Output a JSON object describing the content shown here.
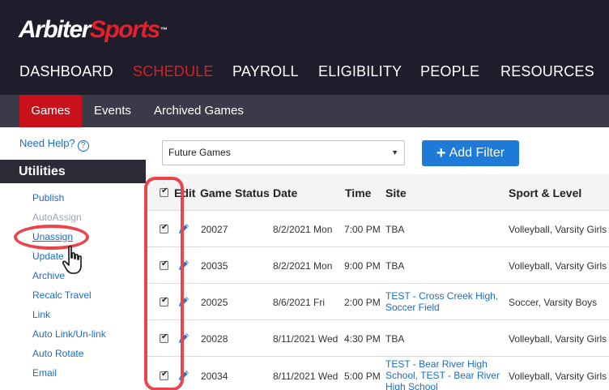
{
  "brand": {
    "logo_part1": "Arbiter",
    "logo_part2": "Sports",
    "logo_mark": "™"
  },
  "main_nav": [
    {
      "label": "DASHBOARD",
      "active": false
    },
    {
      "label": "SCHEDULE",
      "active": true
    },
    {
      "label": "PAYROLL",
      "active": false
    },
    {
      "label": "ELIGIBILITY",
      "active": false
    },
    {
      "label": "PEOPLE",
      "active": false
    },
    {
      "label": "RESOURCES",
      "active": false
    }
  ],
  "sub_nav": [
    {
      "label": "Games",
      "active": true
    },
    {
      "label": "Events",
      "active": false
    },
    {
      "label": "Archived Games",
      "active": false
    }
  ],
  "sidebar": {
    "help_label": "Need Help?",
    "help_icon": "question-circle-icon",
    "section_title": "Utilities",
    "items": [
      {
        "label": "Publish",
        "state": "normal"
      },
      {
        "label": "AutoAssign",
        "state": "disabled"
      },
      {
        "label": "Unassign",
        "state": "highlighted"
      },
      {
        "label": "Update",
        "state": "normal"
      },
      {
        "label": "Archive",
        "state": "normal"
      },
      {
        "label": "Recalc Travel",
        "state": "normal"
      },
      {
        "label": "Link",
        "state": "normal"
      },
      {
        "label": "Auto Link/Un-link",
        "state": "normal"
      },
      {
        "label": "Auto Rotate",
        "state": "normal"
      },
      {
        "label": "Email",
        "state": "normal"
      }
    ]
  },
  "filter": {
    "selected": "Future Games",
    "add_filter_label": "Add Filter"
  },
  "table": {
    "columns": [
      "Edit",
      "Game",
      "Status",
      "Date",
      "Time",
      "Site",
      "Sport & Level"
    ],
    "select_all_checked": true,
    "rows": [
      {
        "checked": true,
        "game": "20027",
        "status": "",
        "date": "8/2/2021 Mon",
        "time": "7:00 PM",
        "site": "TBA",
        "site_is_link": false,
        "sport_level": "Volleyball, Varsity Girls"
      },
      {
        "checked": true,
        "game": "20035",
        "status": "",
        "date": "8/2/2021 Mon",
        "time": "9:00 PM",
        "site": "TBA",
        "site_is_link": false,
        "sport_level": "Volleyball, Varsity Girls"
      },
      {
        "checked": true,
        "game": "20025",
        "status": "",
        "date": "8/6/2021 Fri",
        "time": "2:00 PM",
        "site": "TEST - Cross Creek High, Soccer Field",
        "site_is_link": true,
        "sport_level": "Soccer, Varsity Boys"
      },
      {
        "checked": true,
        "game": "20028",
        "status": "",
        "date": "8/11/2021 Wed",
        "time": "4:30 PM",
        "site": "TBA",
        "site_is_link": false,
        "sport_level": "Volleyball, Varsity Girls"
      },
      {
        "checked": true,
        "game": "20034",
        "status": "",
        "date": "8/11/2021 Wed",
        "time": "5:00 PM",
        "site": "TEST - Bear River High School, TEST - Bear River High School",
        "site_is_link": true,
        "sport_level": "Volleyball, Varsity Girls"
      }
    ]
  },
  "colors": {
    "header_bg": "#1f1d2b",
    "accent_red": "#d61f26",
    "link_blue": "#1a6cc7",
    "button_blue": "#1d7ad6",
    "annotation_red": "#e8464b"
  },
  "icons": {
    "edit": "pencil-icon",
    "cursor": "hand-pointer-icon",
    "dropdown": "caret-down-icon",
    "add": "plus-icon"
  }
}
